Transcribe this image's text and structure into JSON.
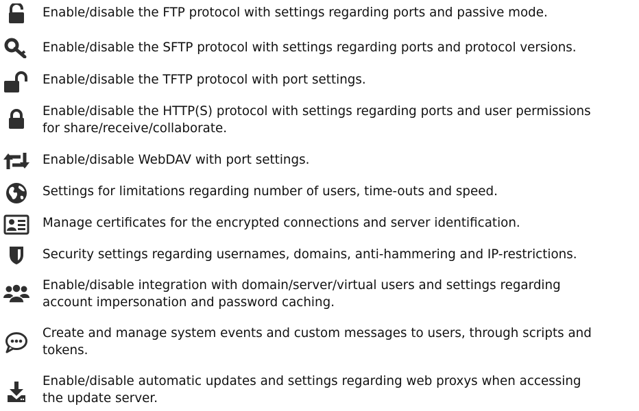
{
  "colors": {
    "icon": "#2f2f2f",
    "text": "#111111",
    "background": "#ffffff"
  },
  "items": [
    {
      "icon": "unlocked-padlock-icon",
      "lines": [
        "Enable/disable the FTP protocol with settings regarding ports and passive mode."
      ]
    },
    {
      "icon": "key-icon",
      "lines": [
        "Enable/disable the SFTP protocol with settings regarding ports and protocol versions."
      ]
    },
    {
      "icon": "open-lock-icon",
      "lines": [
        "Enable/disable the TFTP protocol with port settings."
      ]
    },
    {
      "icon": "locked-padlock-icon",
      "lines": [
        "Enable/disable the HTTP(S) protocol with settings regarding ports and user permissions",
        "for share/receive/collaborate."
      ]
    },
    {
      "icon": "sync-arrows-icon",
      "lines": [
        "Enable/disable WebDAV with port settings."
      ]
    },
    {
      "icon": "globe-icon",
      "lines": [
        "Settings for limitations regarding number of users, time-outs and speed."
      ]
    },
    {
      "icon": "id-card-icon",
      "lines": [
        "Manage certificates for the encrypted connections and server identification."
      ]
    },
    {
      "icon": "shield-icon",
      "lines": [
        "Security settings regarding usernames, domains, anti-hammering and IP-restrictions."
      ]
    },
    {
      "icon": "users-group-icon",
      "lines": [
        "Enable/disable integration with domain/server/virtual users and settings regarding",
        "account impersonation and password caching."
      ]
    },
    {
      "icon": "chat-bubble-icon",
      "lines": [
        "Create and manage system events and custom messages to users, through scripts and",
        "tokens."
      ]
    },
    {
      "icon": "download-icon",
      "lines": [
        "Enable/disable automatic updates and settings regarding web proxys when accessing",
        "the update server."
      ]
    }
  ]
}
